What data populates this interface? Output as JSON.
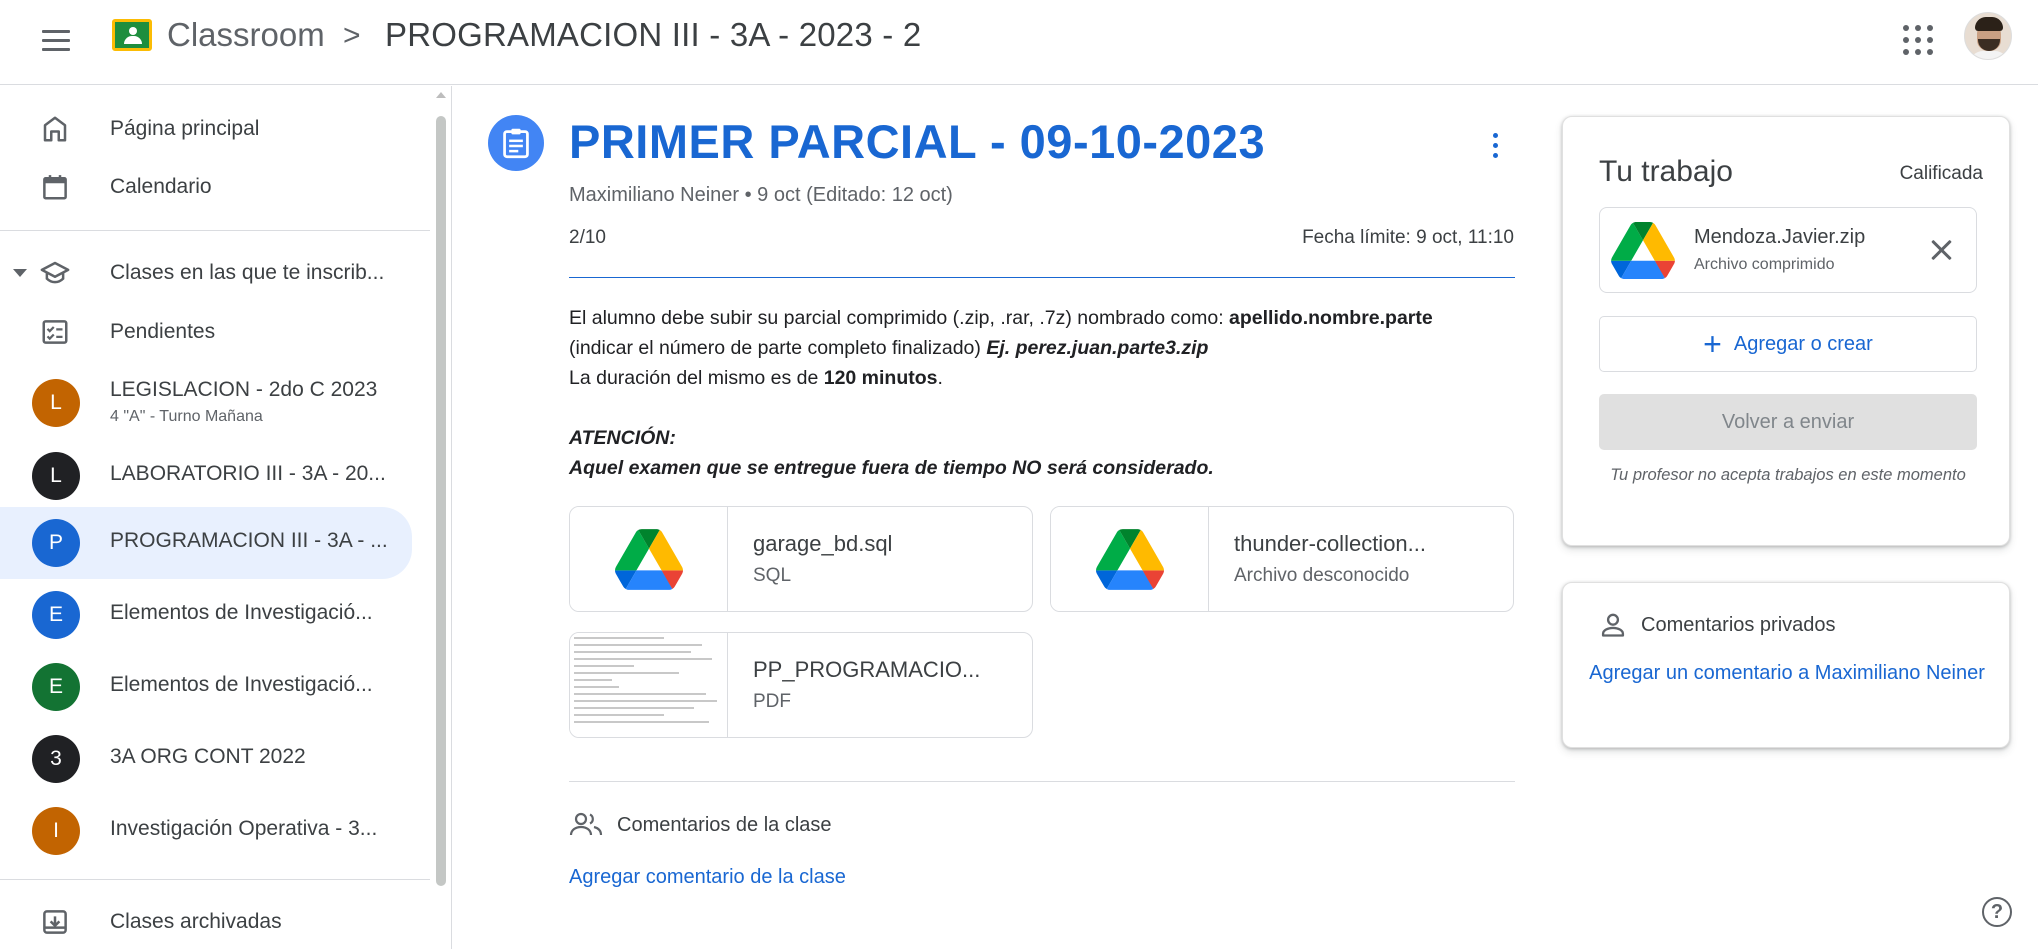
{
  "header": {
    "app_title": "Classroom",
    "breadcrumb_separator": ">",
    "class_title": "PROGRAMACION III - 3A - 2023 - 2"
  },
  "sidebar": {
    "home": "Página principal",
    "calendar": "Calendario",
    "enrolled": "Clases en las que te inscrib...",
    "todo": "Pendientes",
    "classes": [
      {
        "letter": "L",
        "name": "LEGISLACION - 2do C 2023",
        "subtitle": "4 \"A\" - Turno Mañana",
        "color": "#c26401"
      },
      {
        "letter": "L",
        "name": "LABORATORIO III - 3A - 20...",
        "subtitle": "",
        "color": "#202124"
      },
      {
        "letter": "P",
        "name": "PROGRAMACION III - 3A - ...",
        "subtitle": "",
        "color": "#1967d2"
      },
      {
        "letter": "E",
        "name": "Elementos de Investigació...",
        "subtitle": "",
        "color": "#1967d2"
      },
      {
        "letter": "E",
        "name": "Elementos de Investigació...",
        "subtitle": "",
        "color": "#137333"
      },
      {
        "letter": "3",
        "name": "3A ORG CONT 2022",
        "subtitle": "",
        "color": "#202124"
      },
      {
        "letter": "I",
        "name": "Investigación Operativa - 3...",
        "subtitle": "",
        "color": "#c26401"
      }
    ],
    "archived": "Clases archivadas"
  },
  "assignment": {
    "title": "PRIMER PARCIAL - 09-10-2023",
    "meta": "Maximiliano Neiner • 9 oct (Editado: 12 oct)",
    "grade": "2/10",
    "due": "Fecha límite: 9 oct, 11:10",
    "instructions": {
      "l1_text": "El alumno debe subir su parcial comprimido (.zip, .rar, .7z) nombrado como: ",
      "l1_bold": "apellido.nombre.parte",
      "l2_text": "(indicar el número de parte completo finalizado) ",
      "l2_bold_italic": "Ej. perez.juan.parte3.zip",
      "l3_text": "La duración del mismo es de ",
      "l3_bold": "120 minutos",
      "l3_end": ".",
      "attention": "ATENCIÓN:",
      "warning": "Aquel examen que se entregue fuera de tiempo NO será considerado."
    },
    "attachments": [
      {
        "name": "garage_bd.sql",
        "type": "SQL",
        "icon": "google-drive-icon"
      },
      {
        "name": "thunder-collection...",
        "type": "Archivo desconocido",
        "icon": "google-drive-icon"
      },
      {
        "name": "PP_PROGRAMACIO...",
        "type": "PDF",
        "icon": "pdf-preview"
      }
    ],
    "class_comments_label": "Comentarios de la clase",
    "add_class_comment": "Agregar comentario de la clase"
  },
  "your_work": {
    "title": "Tu trabajo",
    "status": "Calificada",
    "file_name": "Mendoza.Javier.zip",
    "file_type": "Archivo comprimido",
    "add_or_create": "Agregar o crear",
    "resubmit": "Volver a enviar",
    "not_accepting": "Tu profesor no acepta trabajos en este momento"
  },
  "private_comments": {
    "label": "Comentarios privados",
    "add": "Agregar un comentario a Maximiliano Neiner"
  },
  "help": "?",
  "colors": {
    "accent": "#1967d2",
    "assignment_icon_bg": "#4285f4",
    "active_bg": "#e8f0fe"
  }
}
